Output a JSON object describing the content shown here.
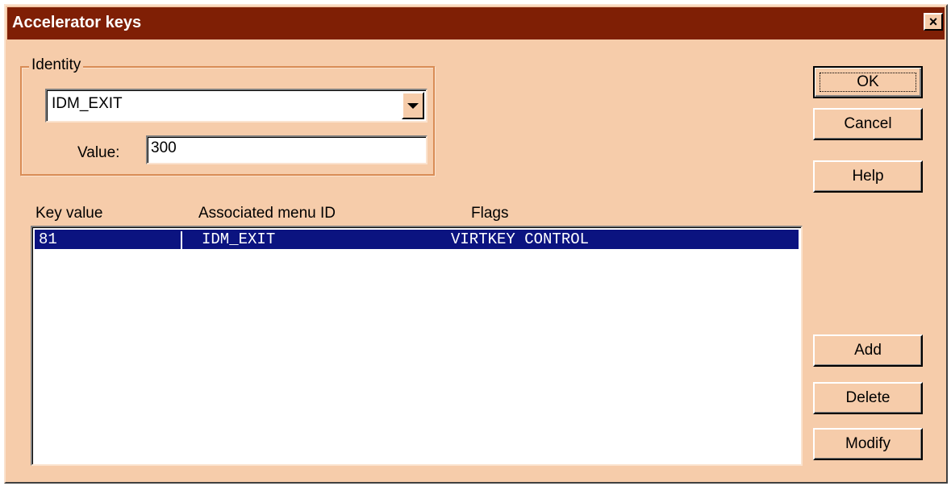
{
  "window": {
    "title": "Accelerator keys",
    "close_label": "×"
  },
  "identity_group": {
    "label": "Identity",
    "identity_value": "IDM_EXIT",
    "value_label": "Value:",
    "value": "300"
  },
  "list": {
    "columns": [
      "Key value",
      "Associated menu ID",
      "Flags"
    ],
    "rows": [
      {
        "key_value": "81",
        "menu_id": "IDM_EXIT",
        "flags": "VIRTKEY CONTROL",
        "selected": true
      }
    ]
  },
  "buttons": {
    "ok": "OK",
    "cancel": "Cancel",
    "help": "Help",
    "add": "Add",
    "delete": "Delete",
    "modify": "Modify"
  },
  "colors": {
    "titlebar": "#7f1f05",
    "dialog_background": "#f6ccaa",
    "selection": "#0b1380"
  },
  "icons": {
    "close": "close-icon",
    "dropdown": "chevron-down-icon"
  }
}
